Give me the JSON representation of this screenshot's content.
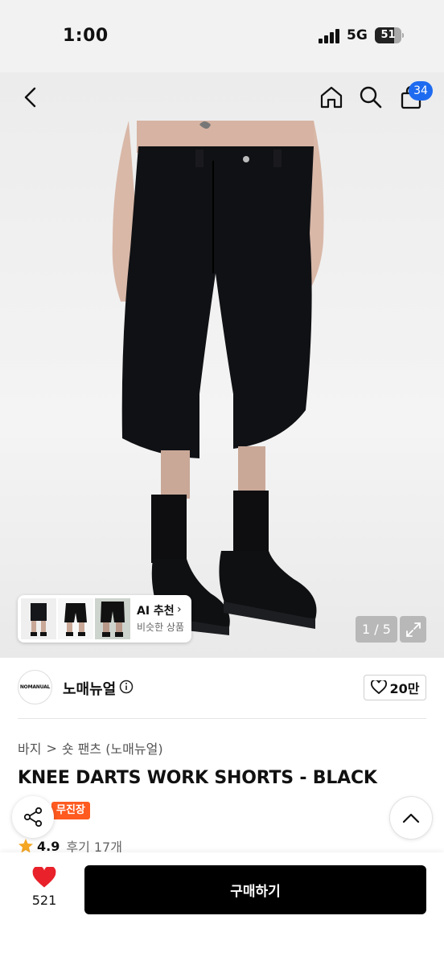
{
  "status_bar": {
    "time": "1:00",
    "network": "5G",
    "battery": "51"
  },
  "header": {
    "cart_count": "34"
  },
  "gallery": {
    "ai_label": "AI 추천",
    "ai_sub": "비슷한 상품",
    "counter": "1 / 5"
  },
  "brand": {
    "logo_text": "NOMANUAL",
    "name": "노매뉴얼",
    "likes": "20만"
  },
  "breadcrumb": {
    "category": "바지",
    "separator": ">",
    "subcategory": "숏 팬츠 (노매뉴얼)"
  },
  "product": {
    "title": "KNEE DARTS WORK SHORTS - BLACK",
    "tag": "무진장",
    "rating": "4.9",
    "reviews": "후기 17개"
  },
  "bottom_bar": {
    "fav_count": "521",
    "buy_label": "구매하기"
  },
  "colors": {
    "accent": "#1e6bf0",
    "tag": "#ff5a1f",
    "buy": "#000000",
    "heart": "#e8212a"
  }
}
